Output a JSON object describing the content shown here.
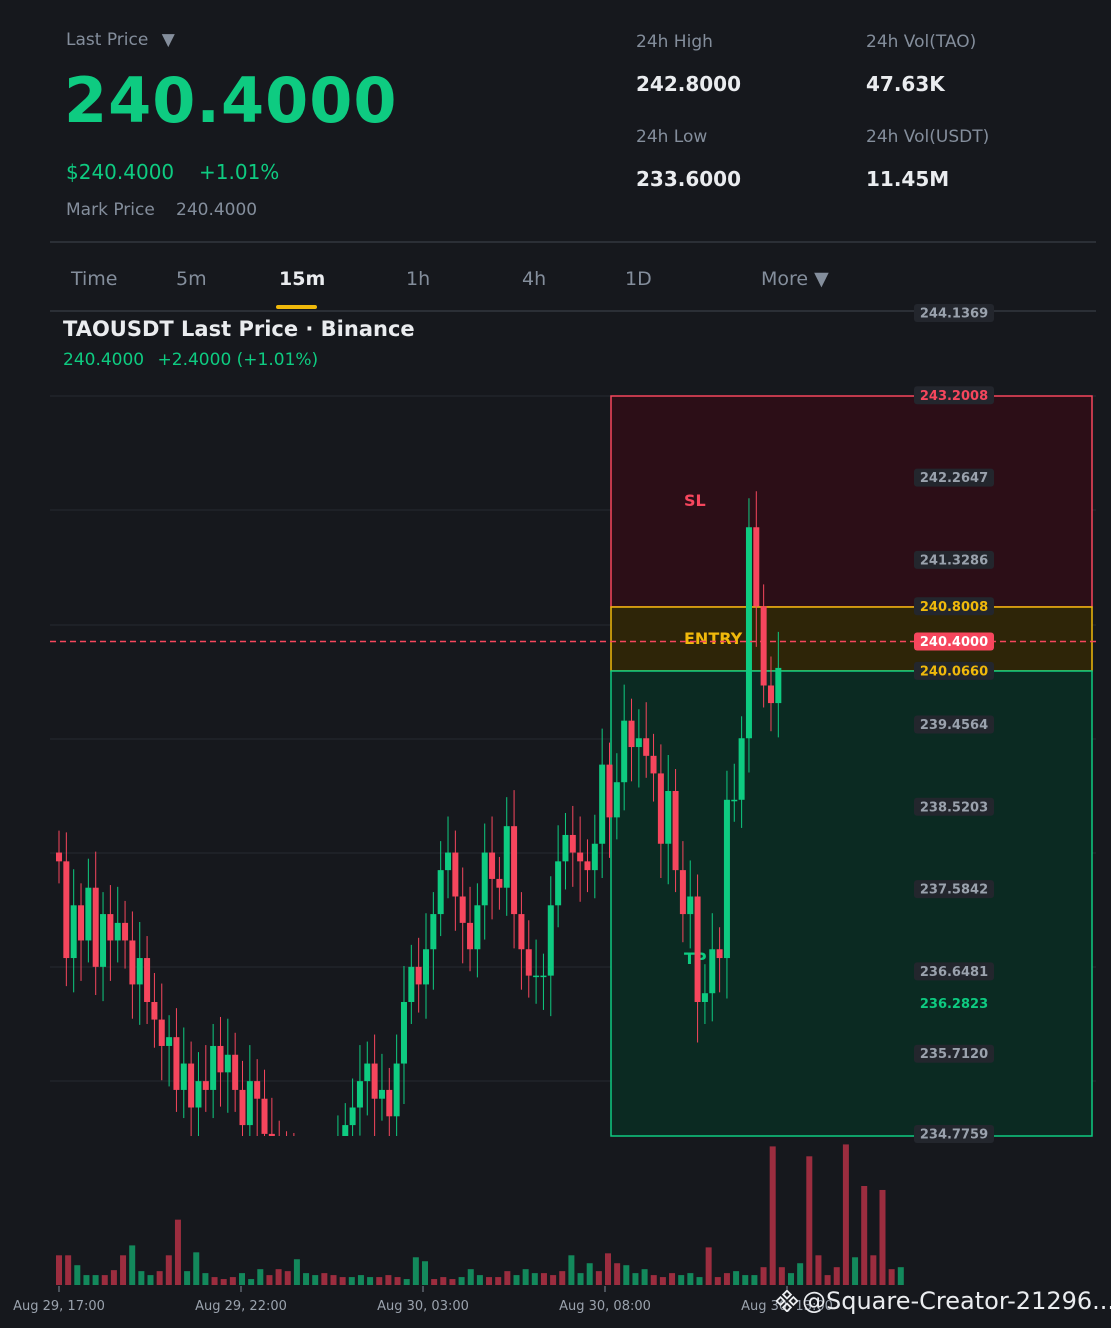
{
  "header": {
    "last_price_label": "Last Price",
    "last_price_caret": "▼",
    "price": "240.4000",
    "usd_price": "$240.4000",
    "change_pct": "+1.01%",
    "mark_label": "Mark Price",
    "mark_value": "240.4000"
  },
  "stats": {
    "high_label": "24h High",
    "high_value": "242.8000",
    "vol_tao_label": "24h Vol(TAO)",
    "vol_tao_value": "47.63K",
    "low_label": "24h Low",
    "low_value": "233.6000",
    "vol_usdt_label": "24h Vol(USDT)",
    "vol_usdt_value": "11.45M"
  },
  "tabs": [
    {
      "label": "Time",
      "active": false
    },
    {
      "label": "5m",
      "active": false
    },
    {
      "label": "15m",
      "active": true
    },
    {
      "label": "1h",
      "active": false
    },
    {
      "label": "4h",
      "active": false
    },
    {
      "label": "1D",
      "active": false
    },
    {
      "label": "More ▼",
      "active": false
    }
  ],
  "chart": {
    "title": "TAOUSDT Last Price · Binance",
    "price": "240.4000",
    "change": "+2.4000 (+1.01%)",
    "y_axis_labels": [
      "244.1369",
      "243.2008",
      "242.2647",
      "241.3286",
      "240.8008",
      "240.4000",
      "240.0660",
      "239.4564",
      "238.5203",
      "237.5842",
      "236.6481",
      "236.2823",
      "235.7120",
      "234.7759"
    ],
    "sl_label": "SL",
    "entry_label": "ENTRY",
    "tp_label": "TP",
    "sl_price": "243.2008",
    "entry_price": "240.8008",
    "current_price": "240.4000",
    "tp_price": "240.0660",
    "low_marker": "236.2823",
    "x_labels": [
      "Aug 29, 17:00",
      "Aug 29, 22:00",
      "Aug 30, 03:00",
      "Aug 30, 08:00",
      "Aug 30, 13:00"
    ],
    "colors": {
      "up": "#0ecb81",
      "down": "#f6465d",
      "sl": "#f6465d",
      "entry": "#f0b90b",
      "tp": "#0ecb81"
    }
  },
  "watermark": "@Square-Creator-21296..."
}
